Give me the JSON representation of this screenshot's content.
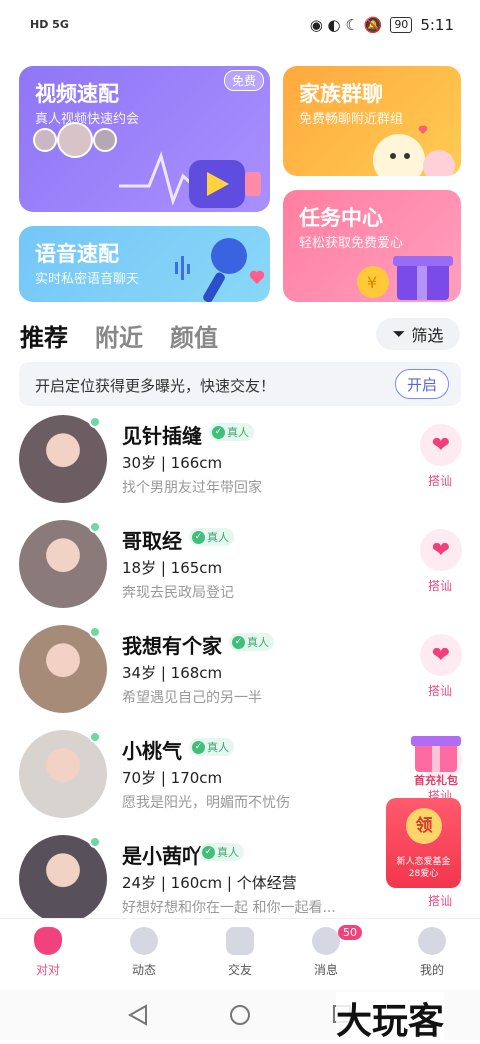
{
  "status_bar": {
    "left": "HD 5G",
    "right_time": "5:11",
    "battery": "90"
  },
  "cards": {
    "video": {
      "title": "视频速配",
      "subtitle": "真人视频快速约会",
      "badge": "免费"
    },
    "voice": {
      "title": "语音速配",
      "subtitle": "实时私密语音聊天"
    },
    "family": {
      "title": "家族群聊",
      "subtitle": "免费畅聊附近群组"
    },
    "task": {
      "title": "任务中心",
      "subtitle": "轻松获取免费爱心"
    }
  },
  "tabs": [
    "推荐",
    "附近",
    "颜值"
  ],
  "filter_label": "筛选",
  "notice": {
    "text": "开启定位获得更多曝光，快速交友！",
    "button": "开启"
  },
  "users": [
    {
      "name": "见针插缝",
      "verified": "真人",
      "meta": "30岁 | 166cm",
      "bio": "找个男朋友过年带回家",
      "action": "搭讪"
    },
    {
      "name": "哥取经",
      "verified": "真人",
      "meta": "18岁 | 165cm",
      "bio": "奔现去民政局登记",
      "action": "搭讪"
    },
    {
      "name": "我想有个家",
      "verified": "真人",
      "meta": "34岁 | 168cm",
      "bio": "希望遇见自己的另一半",
      "action": "搭讪"
    },
    {
      "name": "小桃气",
      "verified": "真人",
      "meta": "70岁 | 170cm",
      "bio": "愿我是阳光，明媚而不忧伤",
      "action": "搭讪"
    },
    {
      "name": "是小茜吖",
      "verified": "真人",
      "meta": "24岁 | 160cm | 个体经营",
      "bio": "好想好想和你在一起 和你一起看...",
      "action": "搭讪"
    }
  ],
  "promo": {
    "gift_label": "首充礼包",
    "redpack_coin": "领",
    "redpack_line1": "新人恋爱基金",
    "redpack_line2": "28爱心"
  },
  "nav": {
    "items": [
      "对对",
      "动态",
      "交友",
      "消息",
      "我的"
    ],
    "message_badge": "50"
  },
  "watermark": "大玩客",
  "colors": {
    "accent": "#ef4d83",
    "online": "#6bd9a0"
  }
}
